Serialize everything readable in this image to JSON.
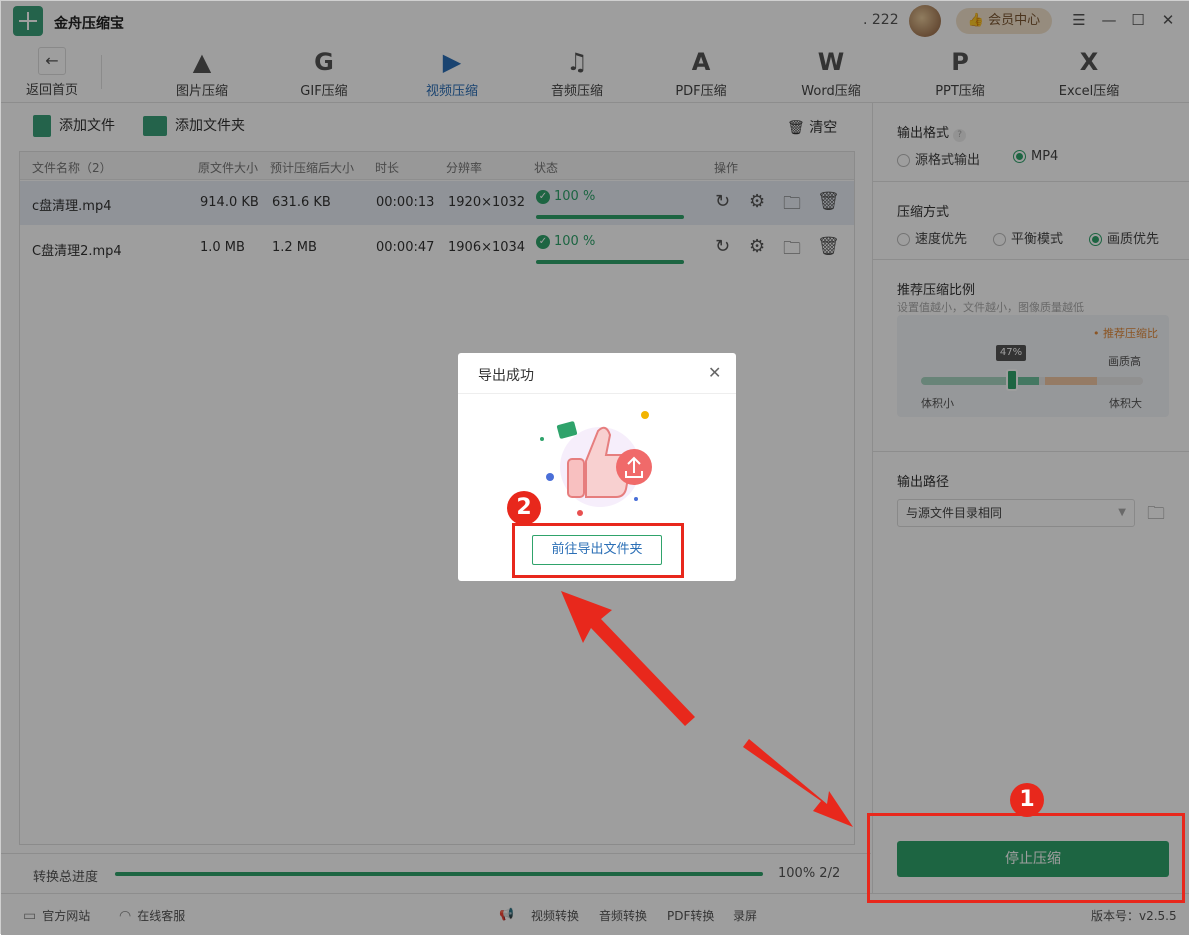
{
  "app": {
    "title": "金舟压缩宝",
    "points": ". 222",
    "vip_label": "会员中心"
  },
  "window": {
    "menu": "☰",
    "minimize": "—",
    "maximize": "☐",
    "close": "✕"
  },
  "toolbar": {
    "back_label": "返回首页",
    "tools": [
      {
        "label": "图片压缩",
        "icon": "image-compress-icon"
      },
      {
        "label": "GIF压缩",
        "icon": "gif-compress-icon"
      },
      {
        "label": "视频压缩",
        "icon": "video-compress-icon",
        "active": true
      },
      {
        "label": "音频压缩",
        "icon": "audio-compress-icon"
      },
      {
        "label": "PDF压缩",
        "icon": "pdf-compress-icon"
      },
      {
        "label": "Word压缩",
        "icon": "word-compress-icon"
      },
      {
        "label": "PPT压缩",
        "icon": "ppt-compress-icon"
      },
      {
        "label": "Excel压缩",
        "icon": "excel-compress-icon"
      }
    ]
  },
  "actions": {
    "add_file": "添加文件",
    "add_folder": "添加文件夹",
    "clear": "清空"
  },
  "table": {
    "headers": [
      "文件名称（2）",
      "原文件大小",
      "预计压缩后大小",
      "时长",
      "分辨率",
      "状态",
      "操作"
    ],
    "rows": [
      {
        "name": "c盘清理.mp4",
        "orig_size": "914.0 KB",
        "est_size": "631.6 KB",
        "duration": "00:00:13",
        "resolution": "1920×1032",
        "status": "100 %",
        "progress": 1.0,
        "selected": true
      },
      {
        "name": "C盘清理2.mp4",
        "orig_size": "1.0 MB",
        "est_size": "1.2 MB",
        "duration": "00:00:47",
        "resolution": "1906×1034",
        "status": "100 %",
        "progress": 1.0,
        "selected": false
      }
    ]
  },
  "progress": {
    "label": "转换总进度",
    "value_text": "100% 2/2",
    "fraction": 1.0
  },
  "footer": {
    "website": "官方网站",
    "service": "在线客服",
    "links": [
      "视频转换",
      "音频转换",
      "PDF转换",
      "录屏"
    ],
    "version": "版本号：v2.5.5"
  },
  "settings": {
    "output_format": {
      "title": "输出格式",
      "help": "?",
      "options": [
        "源格式输出",
        "MP4"
      ],
      "selected": "MP4"
    },
    "compress_mode": {
      "title": "压缩方式",
      "options": [
        "速度优先",
        "平衡模式",
        "画质优先"
      ],
      "selected": "画质优先"
    },
    "ratio": {
      "title": "推荐压缩比例",
      "hint": "设置值越小，文件越小，图像质量越低",
      "recommend": "• 推荐压缩比",
      "high_quality": "画质高",
      "small": "体积小",
      "large": "体积大",
      "value": "47%",
      "fraction": 0.47
    },
    "output_path": {
      "title": "输出路径",
      "value": "与源文件目录相同"
    },
    "stop_button": "停止压缩"
  },
  "dialog": {
    "title": "导出成功",
    "close": "✕",
    "open_folder": "前往导出文件夹"
  },
  "annotations": {
    "badge1": "1",
    "badge2": "2"
  },
  "colors": {
    "accent": "#2fa36b",
    "active_tab": "#2b6fb6",
    "highlight": "#e8281c"
  }
}
